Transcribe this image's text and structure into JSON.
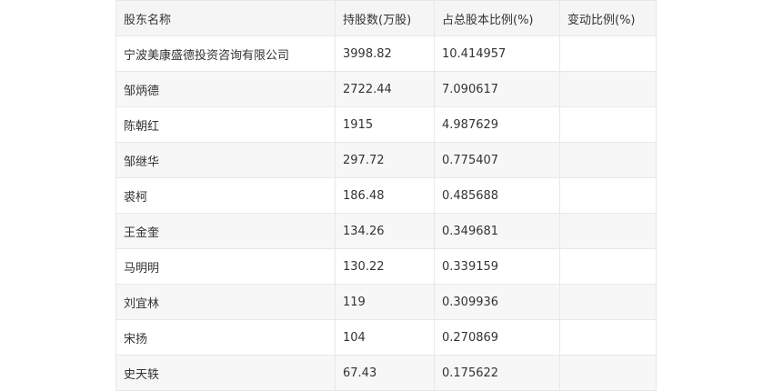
{
  "table": {
    "headers": [
      "股东名称",
      "持股数(万股)",
      "占总股本比例(%)",
      "变动比例(%)"
    ],
    "rows": [
      [
        "宁波美康盛德投资咨询有限公司",
        "3998.82",
        "10.414957",
        ""
      ],
      [
        "邹炳德",
        "2722.44",
        "7.090617",
        ""
      ],
      [
        "陈朝红",
        "1915",
        "4.987629",
        ""
      ],
      [
        "邹继华",
        "297.72",
        "0.775407",
        ""
      ],
      [
        "裘柯",
        "186.48",
        "0.485688",
        ""
      ],
      [
        "王金奎",
        "134.26",
        "0.349681",
        ""
      ],
      [
        "马明明",
        "130.22",
        "0.339159",
        ""
      ],
      [
        "刘宜林",
        "119",
        "0.309936",
        ""
      ],
      [
        "宋扬",
        "104",
        "0.270869",
        ""
      ],
      [
        "史天轶",
        "67.43",
        "0.175622",
        ""
      ]
    ]
  }
}
